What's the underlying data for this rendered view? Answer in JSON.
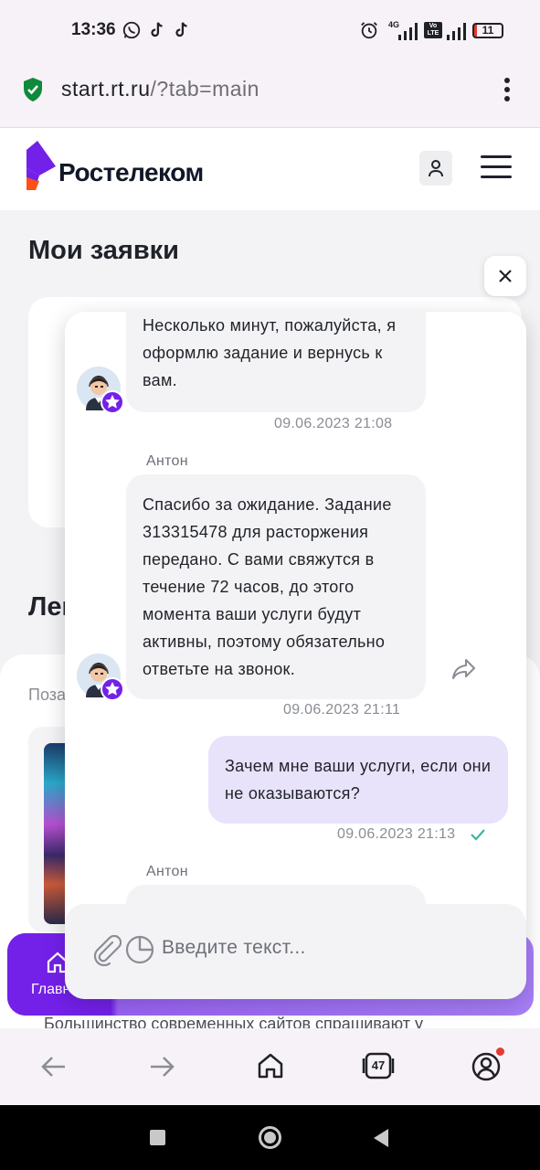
{
  "status_bar": {
    "time": "13:36",
    "network_badge": "4G",
    "volte_badge": "Vo LTE",
    "battery": "11"
  },
  "browser": {
    "url_host": "start.rt.ru",
    "url_path": "/?tab=main",
    "tabs_count": "47"
  },
  "site": {
    "brand": "Ростелеком",
    "page_title": "Мои заявки",
    "section_title_partial": "Лен",
    "panel_label_partial": "Поза",
    "nav_home_label": "Главн",
    "bottom_text_partial": "Большинство современных сайтов спрашивают у"
  },
  "chat": {
    "messages": [
      {
        "text": "Несколько минут, пожалуйста, я оформлю задание и вернусь к вам.",
        "time": "09.06.2023 21:08"
      },
      {
        "sender": "Антон",
        "text": "Спасибо за ожидание. Задание 313315478 для расторжения передано. С вами свяжутся в течение 72 часов, до этого момента ваши услуги будут активны, поэтому обязательно ответьте на звонок.",
        "time": "09.06.2023 21:11"
      },
      {
        "text": "Зачем мне ваши услуги, если они не оказываются?",
        "time": "09.06.2023 21:13"
      },
      {
        "sender": "Антон"
      }
    ],
    "input_placeholder": "Введите текст..."
  },
  "colors": {
    "brand_purple": "#7320e8",
    "brand_orange": "#ff4f12",
    "outgoing_bubble": "#e8e2fb",
    "incoming_bubble": "#f3f3f5",
    "check_teal": "#3bb6a0"
  }
}
